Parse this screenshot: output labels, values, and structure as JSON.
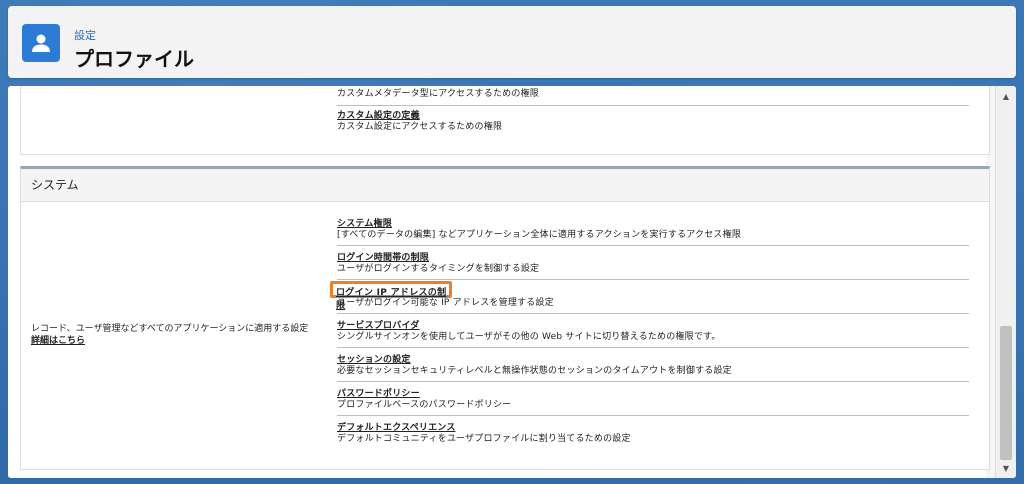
{
  "header": {
    "breadcrumb": "設定",
    "title": "プロファイル"
  },
  "top_section": {
    "items": [
      {
        "desc": "カスタムメタデータ型にアクセスするための権限"
      },
      {
        "title": "カスタム設定の定義",
        "desc": "カスタム設定にアクセスするための権限"
      }
    ]
  },
  "system": {
    "heading": "システム",
    "left_desc": "レコード、ユーザ管理などすべてのアプリケーションに適用する設定",
    "left_link": "詳細はこちら",
    "items": [
      {
        "title": "システム権限",
        "desc": "[すべてのデータの編集] などアプリケーション全体に適用するアクションを実行するアクセス権限"
      },
      {
        "title": "ログイン時間帯の制限",
        "desc": "ユーザがログインするタイミングを制御する設定"
      },
      {
        "title": "ログイン IP アドレスの制限",
        "desc": "ユーザがログイン可能な IP アドレスを管理する設定"
      },
      {
        "title": "サービスプロバイダ",
        "desc": "シングルサインオンを使用してユーザがその他の Web サイトに切り替えるための権限です。"
      },
      {
        "title": "セッションの設定",
        "desc": "必要なセッションセキュリティレベルと無操作状態のセッションのタイムアウトを制御する設定"
      },
      {
        "title": "パスワードポリシー",
        "desc": "プロファイルベースのパスワードポリシー"
      },
      {
        "title": "デフォルトエクスペリエンス",
        "desc": "デフォルトコミュニティをユーザプロファイルに割り当てるための設定"
      }
    ]
  },
  "colors": {
    "highlight": "#f07f23",
    "icon_bg": "#2c7bd4",
    "link": "#1a6fc0"
  },
  "icons": {
    "header": "user-icon",
    "scroll_up": "scroll-up-arrow-icon",
    "scroll_down": "scroll-down-arrow-icon"
  }
}
